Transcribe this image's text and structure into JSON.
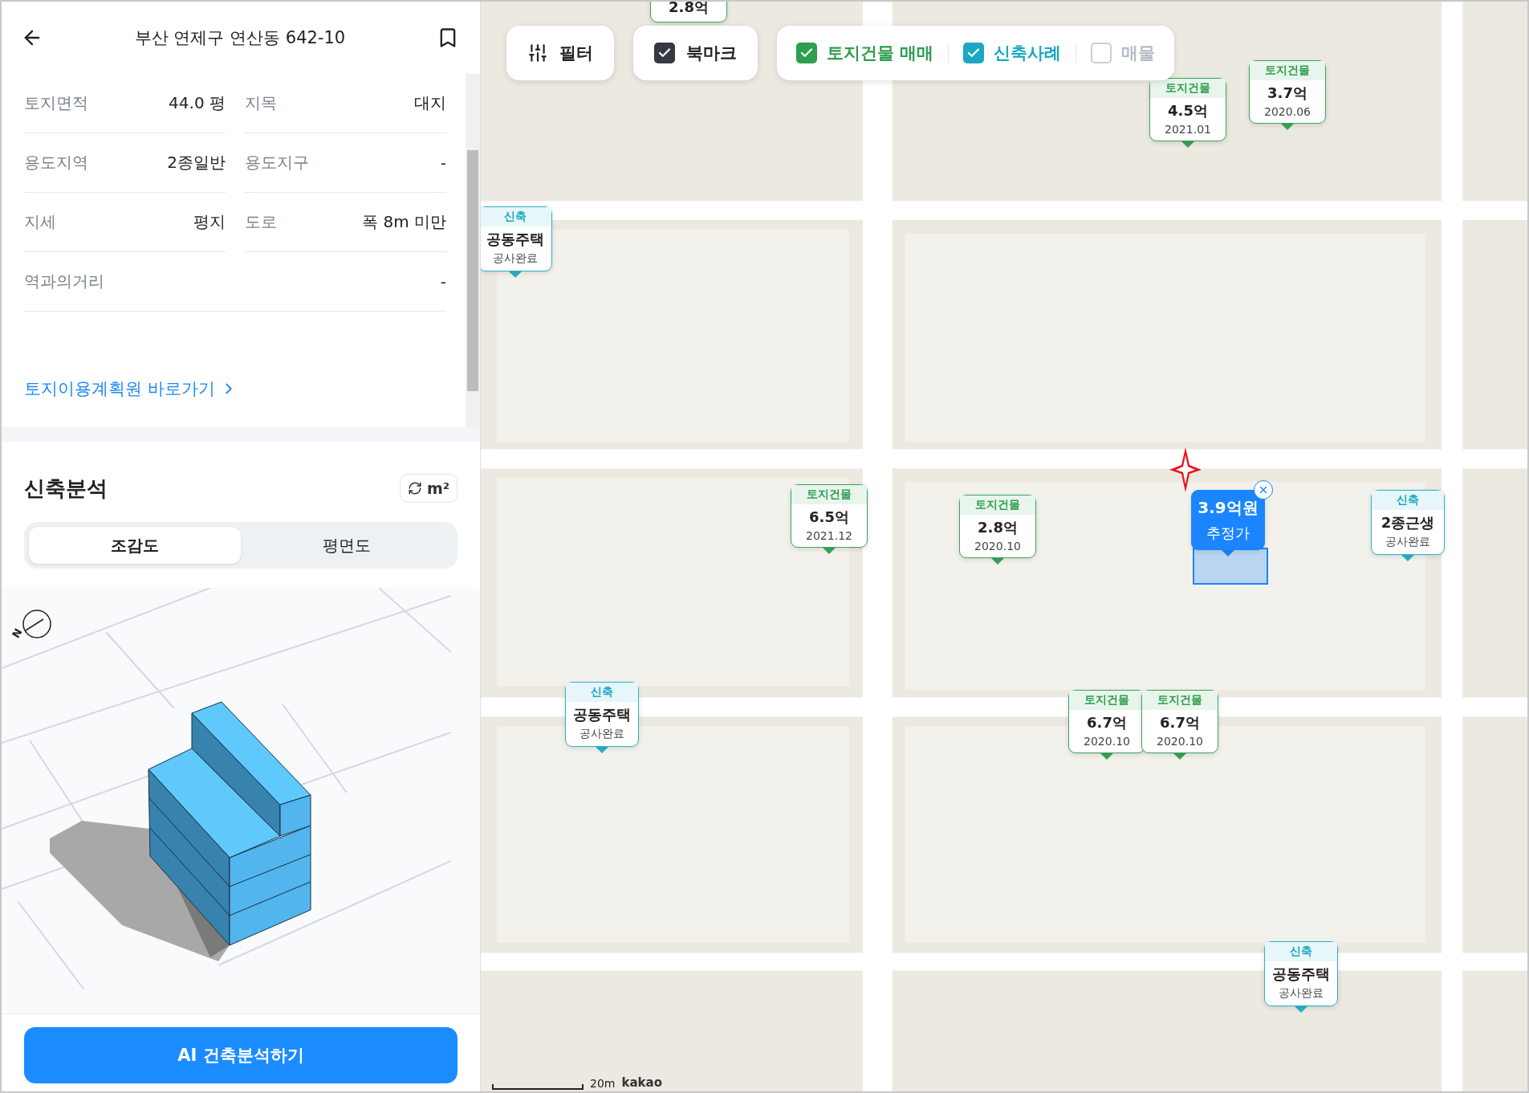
{
  "header": {
    "title": "부산 연제구 연산동 642-10"
  },
  "info_rows": [
    {
      "cells": [
        {
          "label": "토지면적",
          "value": "44.0 평"
        },
        {
          "label": "지목",
          "value": "대지"
        }
      ]
    },
    {
      "cells": [
        {
          "label": "용도지역",
          "value": "2종일반"
        },
        {
          "label": "용도지구",
          "value": "-"
        }
      ]
    },
    {
      "cells": [
        {
          "label": "지세",
          "value": "평지"
        },
        {
          "label": "도로",
          "value": "폭 8m 미만"
        }
      ]
    },
    {
      "cells": [
        {
          "label": "역과의거리",
          "value": "-"
        }
      ]
    }
  ],
  "link": {
    "label": "토지이용계획원 바로가기"
  },
  "analysis": {
    "title": "신축분석",
    "unit_button": "m²",
    "views": [
      {
        "label": "조감도",
        "selected": true
      },
      {
        "label": "평면도",
        "selected": false
      }
    ],
    "compass_label": "N",
    "cta": "AI 건축분석하기"
  },
  "map": {
    "filter_button": {
      "label": "필터"
    },
    "bookmark": {
      "label": "북마크",
      "checked": true
    },
    "layers": [
      {
        "label": "토지건물 매매",
        "checked": true,
        "color": "#2e9e4f"
      },
      {
        "label": "신축사례",
        "checked": true,
        "color": "#1aa8c2"
      },
      {
        "label": "매물",
        "checked": false,
        "color": "#b4bcc6"
      }
    ],
    "markers": [
      {
        "kind": "deal",
        "title": "2.8억"
      },
      {
        "kind": "deal",
        "tag": "토지건물",
        "title": "4.5억",
        "sub": "2021.01"
      },
      {
        "kind": "deal",
        "tag": "토지건물",
        "title": "3.7억",
        "sub": "2020.06"
      },
      {
        "kind": "new",
        "tag": "신축",
        "title": "공동주택",
        "sub": "공사완료"
      },
      {
        "kind": "deal",
        "tag": "토지건물",
        "title": "6.5억",
        "sub": "2021.12"
      },
      {
        "kind": "deal",
        "tag": "토지건물",
        "title": "2.8억",
        "sub": "2020.10"
      },
      {
        "kind": "estimate",
        "title": "3.9억원",
        "sub": "추정가"
      },
      {
        "kind": "new",
        "tag": "신축",
        "title": "2종근생",
        "sub": "공사완료"
      },
      {
        "kind": "new",
        "tag": "신축",
        "title": "공동주택",
        "sub": "공사완료"
      },
      {
        "kind": "deal",
        "tag": "토지건물",
        "title": "6.7억",
        "sub": "2020.10"
      },
      {
        "kind": "deal",
        "tag": "토지건물",
        "title": "6.7억",
        "sub": "2020.10"
      },
      {
        "kind": "new",
        "tag": "신축",
        "title": "공동주택",
        "sub": "공사완료"
      }
    ],
    "scale_label": "20m",
    "attribution": "kakao"
  }
}
